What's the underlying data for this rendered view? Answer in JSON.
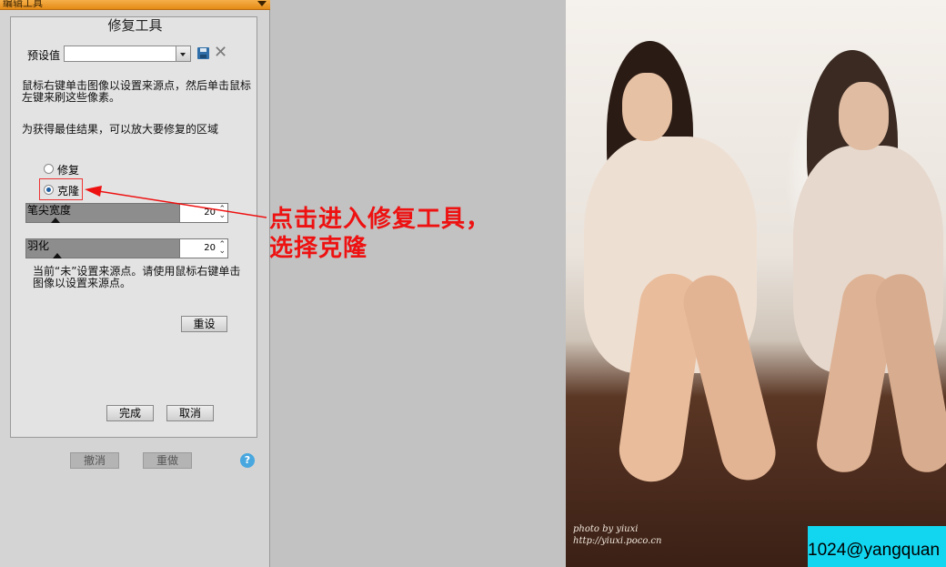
{
  "panel": {
    "header_title": "编辑工具",
    "title": "修复工具",
    "preset_label": "预设值",
    "preset_value": "",
    "instruction_1": "鼠标右键单击图像以设置来源点，然后单击鼠标左键来刷这些像素。",
    "instruction_2": "为获得最佳结果，可以放大要修复的区域",
    "mode_options": [
      {
        "label": "修复",
        "selected": false
      },
      {
        "label": "克隆",
        "selected": true
      }
    ],
    "brush_width": {
      "label": "笔尖宽度",
      "value": "20"
    },
    "feather": {
      "label": "羽化",
      "value": "20"
    },
    "status_text": "当前“未”设置来源点。请使用鼠标右键单击图像以设置来源点。",
    "reset_label": "重设",
    "done_label": "完成",
    "cancel_label": "取消",
    "undo_label": "撤消",
    "redo_label": "重做",
    "help_glyph": "?"
  },
  "annotation": {
    "line1": "点击进入修复工具，",
    "line2": "选择克隆",
    "color": "#ee1111"
  },
  "photo": {
    "credit_line1": "photo by yiuxi",
    "credit_line2": "http://yiuxi.poco.cn"
  },
  "watermark": "1024@yangquan",
  "icons": {
    "save": "save-icon",
    "delete": "delete-icon",
    "help": "help-icon",
    "dropdown": "chevron-down-icon"
  }
}
